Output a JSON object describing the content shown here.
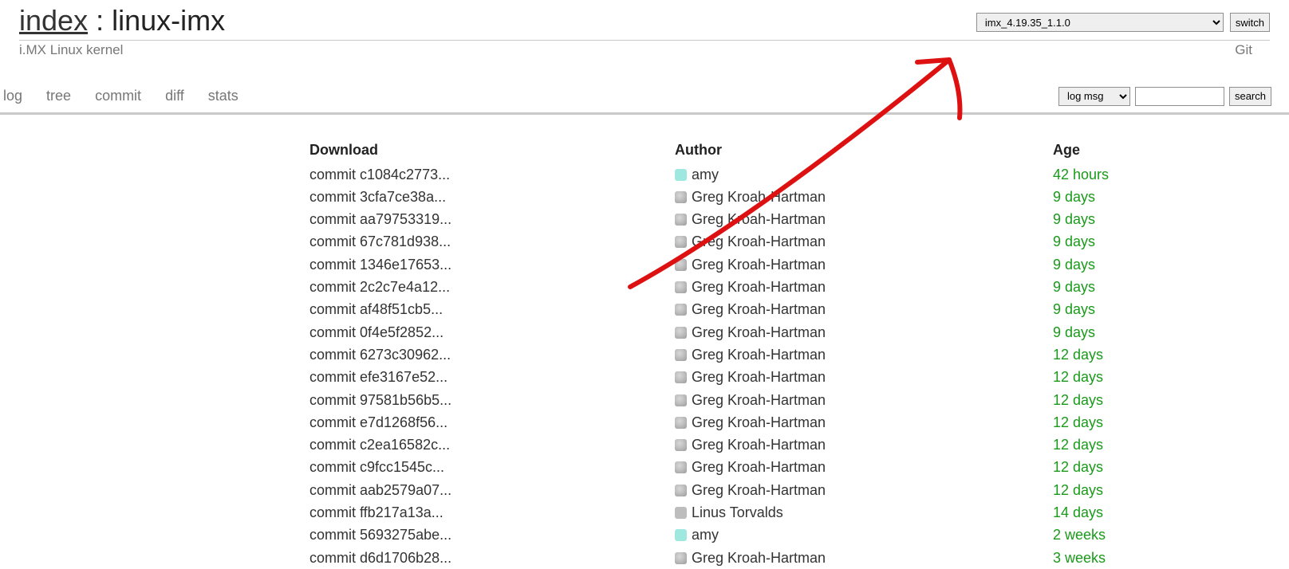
{
  "header": {
    "index_label": "index",
    "separator": " : ",
    "repo_name": "linux-imx",
    "description": "i.MX Linux kernel",
    "git_label": "Git",
    "branch_selected": "imx_4.19.35_1.1.0",
    "switch_label": "switch"
  },
  "tabs": {
    "items": [
      "log",
      "tree",
      "commit",
      "diff",
      "stats"
    ]
  },
  "search": {
    "mode_selected": "log msg",
    "query": "",
    "button_label": "search"
  },
  "table": {
    "headers": {
      "download": "Download",
      "author": "Author",
      "age": "Age"
    },
    "rows": [
      {
        "download": "commit c1084c2773...",
        "author": "amy",
        "age": "42 hours",
        "icon": "teal"
      },
      {
        "download": "commit 3cfa7ce38a...",
        "author": "Greg Kroah-Hartman",
        "age": "9 days",
        "icon": "grav"
      },
      {
        "download": "commit aa79753319...",
        "author": "Greg Kroah-Hartman",
        "age": "9 days",
        "icon": "grav"
      },
      {
        "download": "commit 67c781d938...",
        "author": "Greg Kroah-Hartman",
        "age": "9 days",
        "icon": "grav"
      },
      {
        "download": "commit 1346e17653...",
        "author": "Greg Kroah-Hartman",
        "age": "9 days",
        "icon": "grav"
      },
      {
        "download": "commit 2c2c7e4a12...",
        "author": "Greg Kroah-Hartman",
        "age": "9 days",
        "icon": "grav"
      },
      {
        "download": "commit af48f51cb5...",
        "author": "Greg Kroah-Hartman",
        "age": "9 days",
        "icon": "grav"
      },
      {
        "download": "commit 0f4e5f2852...",
        "author": "Greg Kroah-Hartman",
        "age": "9 days",
        "icon": "grav"
      },
      {
        "download": "commit 6273c30962...",
        "author": "Greg Kroah-Hartman",
        "age": "12 days",
        "icon": "grav"
      },
      {
        "download": "commit efe3167e52...",
        "author": "Greg Kroah-Hartman",
        "age": "12 days",
        "icon": "grav"
      },
      {
        "download": "commit 97581b56b5...",
        "author": "Greg Kroah-Hartman",
        "age": "12 days",
        "icon": "grav"
      },
      {
        "download": "commit e7d1268f56...",
        "author": "Greg Kroah-Hartman",
        "age": "12 days",
        "icon": "grav"
      },
      {
        "download": "commit c2ea16582c...",
        "author": "Greg Kroah-Hartman",
        "age": "12 days",
        "icon": "grav"
      },
      {
        "download": "commit c9fcc1545c...",
        "author": "Greg Kroah-Hartman",
        "age": "12 days",
        "icon": "grav"
      },
      {
        "download": "commit aab2579a07...",
        "author": "Greg Kroah-Hartman",
        "age": "12 days",
        "icon": "grav"
      },
      {
        "download": "commit ffb217a13a...",
        "author": "Linus Torvalds",
        "age": "14 days",
        "icon": "grey"
      },
      {
        "download": "commit 5693275abe...",
        "author": "amy",
        "age": "2 weeks",
        "icon": "teal"
      },
      {
        "download": "commit d6d1706b28...",
        "author": "Greg Kroah-Hartman",
        "age": "3 weeks",
        "icon": "grav"
      }
    ]
  }
}
